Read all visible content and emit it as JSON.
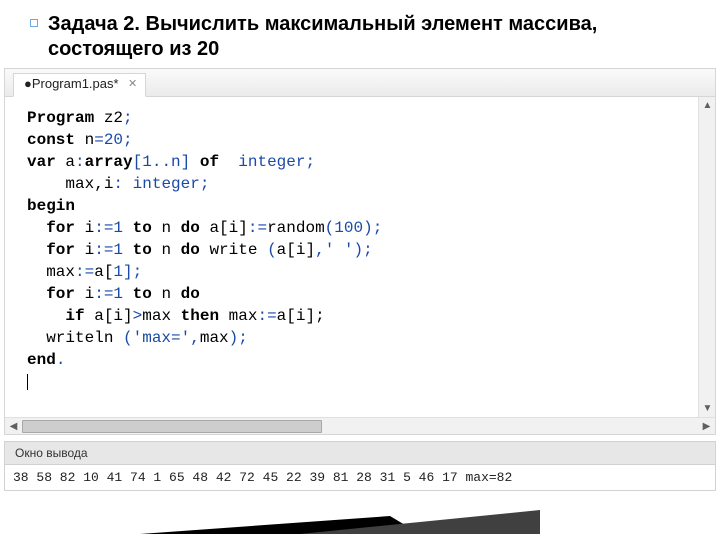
{
  "title": "Задача 2. Вычислить максимальный элемент массива, состоящего из 20",
  "tab_label": "●Program1.pas*",
  "code": {
    "l1_kw": "Program",
    "l1_id": " z2",
    "l1_p": ";",
    "l2_kw": "const",
    "l2_id": " n",
    "l2_eq": "=",
    "l2_n": "20",
    "l2_p": ";",
    "l3_kw": "var",
    "l3_id": " a",
    "l3_c": ":",
    "l3_kw2": "array",
    "l3_br": "[1..n]",
    "l3_of": " of ",
    "l3_tp": " integer",
    "l3_p": ";",
    "l4_id": "    max,i",
    "l4_c": ":",
    "l4_tp": " integer",
    "l4_p": ";",
    "l5_kw": "begin",
    "l6_a": "  ",
    "l6_for": "for",
    "l6_id": " i",
    "l6_as": ":=",
    "l6_n1": "1",
    "l6_to": " to ",
    "l6_n": "n",
    "l6_do": " do ",
    "l6_rest": "a[i]",
    "l6_as2": ":=",
    "l6_rnd": "random",
    "l6_p1": "(",
    "l6_n2": "100",
    "l6_p2": ");",
    "l7_a": "  ",
    "l7_for": "for",
    "l7_id": " i",
    "l7_as": ":=",
    "l7_n1": "1",
    "l7_to": " to ",
    "l7_n": "n",
    "l7_do": " do ",
    "l7_wr": "write ",
    "l7_p1": "(",
    "l7_ai": "a[i]",
    "l7_cm": ",",
    "l7_str": "' '",
    "l7_p2": ");",
    "l8_a": "  ",
    "l8_id": "max",
    "l8_as": ":=",
    "l8_r": "a[",
    "l8_n": "1",
    "l8_rb": "];",
    "l9_a": "  ",
    "l9_for": "for",
    "l9_id": " i",
    "l9_as": ":=",
    "l9_n1": "1",
    "l9_to": " to ",
    "l9_n": "n",
    "l9_do": " do",
    "l10_a": "    ",
    "l10_if": "if",
    "l10_id": " a[i]",
    "l10_gt": ">",
    "l10_m": "max",
    "l10_then": " then ",
    "l10_r": "max",
    "l10_as": ":=",
    "l10_ai": "a[i];",
    "l11_a": "  ",
    "l11_wr": "writeln ",
    "l11_p1": "(",
    "l11_s": "'max='",
    "l11_cm": ",",
    "l11_m": "max",
    "l11_p2": ");",
    "l12_kw": "end",
    "l12_p": "."
  },
  "output_title": "Окно вывода",
  "output_line": "38 58 82 10 41 74 1 65 48 42 72 45 22 39 81 28 31 5 46 17 max=82"
}
